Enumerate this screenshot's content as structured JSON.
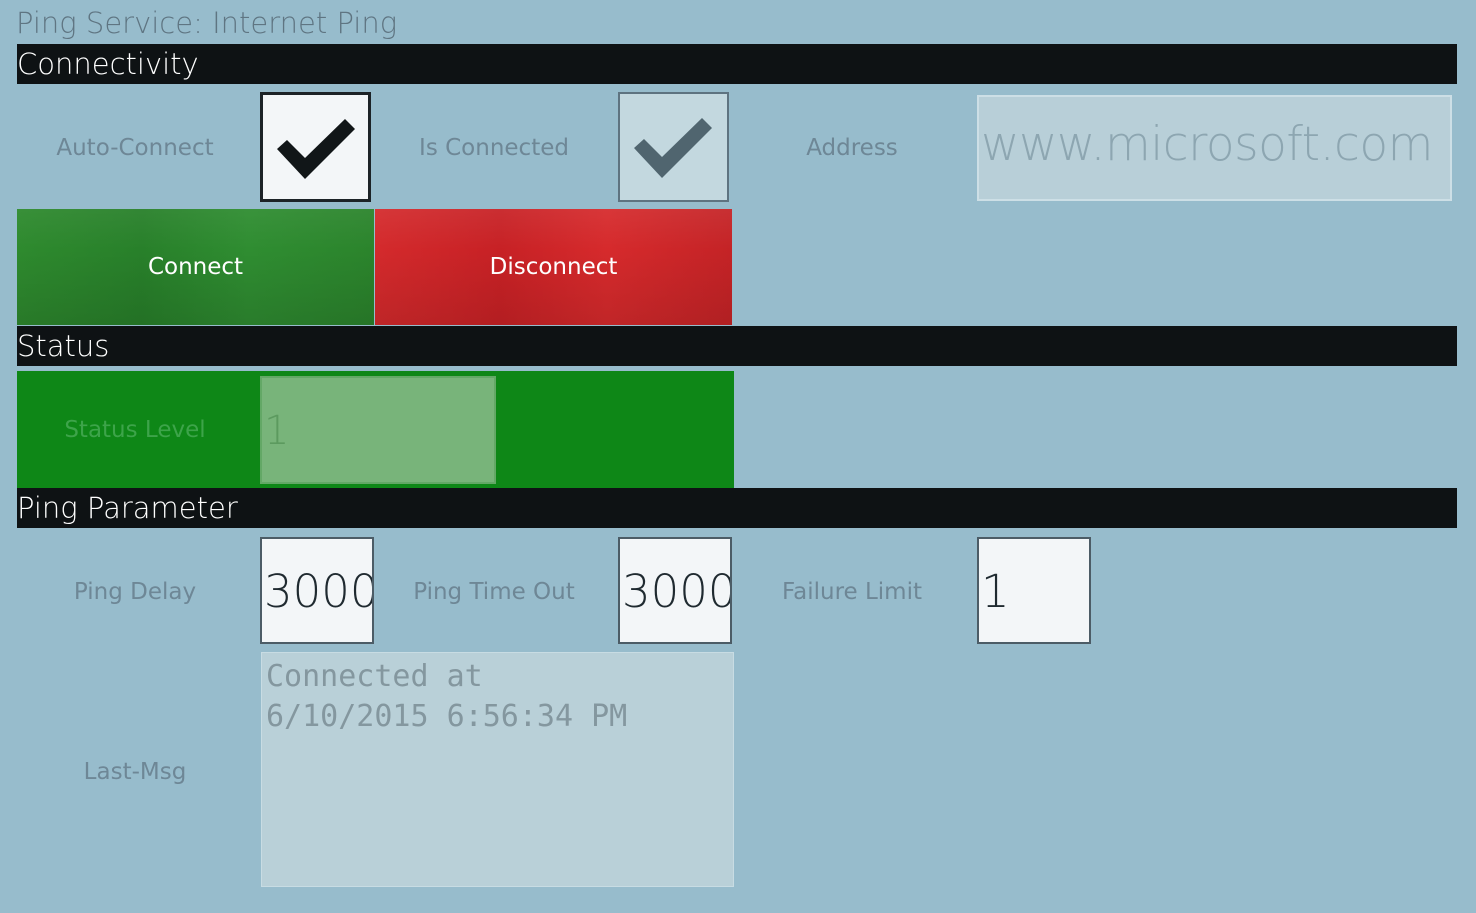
{
  "page": {
    "title": "Ping Service: Internet Ping"
  },
  "sections": {
    "connectivity": "Connectivity",
    "status": "Status",
    "ping_parameter": "Ping Parameter"
  },
  "connectivity": {
    "auto_connect_label": "Auto-Connect",
    "auto_connect_checked": true,
    "is_connected_label": "Is Connected",
    "is_connected_checked": true,
    "address_label": "Address",
    "address_value": "www.microsoft.com",
    "connect_label": "Connect",
    "disconnect_label": "Disconnect"
  },
  "status": {
    "level_label": "Status Level",
    "level_value": "1"
  },
  "ping_parameter": {
    "ping_delay_label": "Ping Delay",
    "ping_delay_value": "3000",
    "ping_timeout_label": "Ping Time Out",
    "ping_timeout_value": "3000",
    "failure_limit_label": "Failure Limit",
    "failure_limit_value": "1",
    "last_msg_label": "Last-Msg",
    "last_msg_value": "Connected at\n6/10/2015 6:56:34 PM"
  },
  "colors": {
    "background": "#97bccc",
    "section_bar": "#0e1214",
    "connect_green": "#2b842c",
    "disconnect_red": "#c72125",
    "status_ok_green": "#0e8717"
  },
  "icons": {
    "checkmark": "checkmark-icon"
  }
}
